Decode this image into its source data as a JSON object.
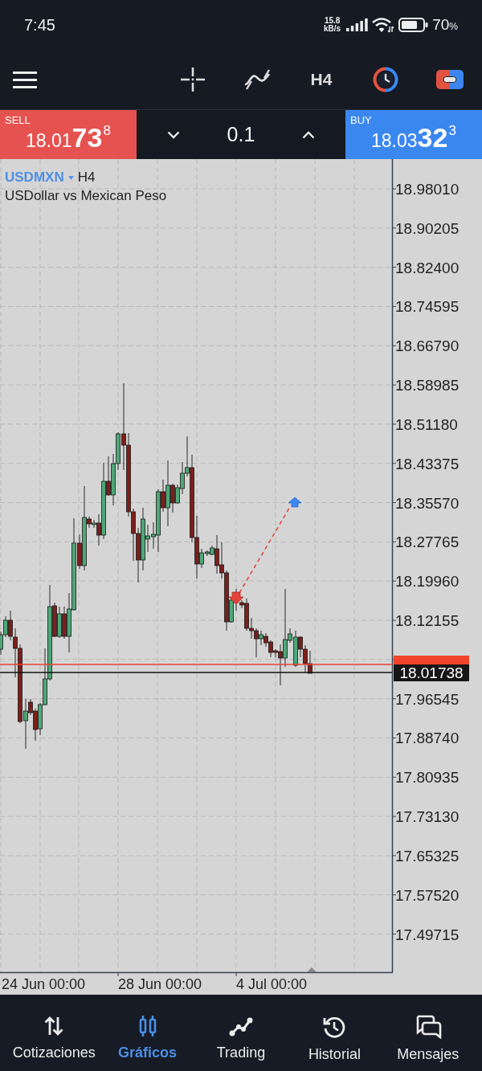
{
  "status_bar": {
    "time": "7:45",
    "net_speed": "15.8",
    "net_unit": "kB/s",
    "battery": "70",
    "battery_unit": "%"
  },
  "toolbar": {
    "timeframe": "H4"
  },
  "trade_panel": {
    "sell": {
      "label": "SELL",
      "price_main": "18.01",
      "price_big": "73",
      "price_sup": "8"
    },
    "volume": "0.1",
    "buy": {
      "label": "BUY",
      "price_main": "18.03",
      "price_big": "32",
      "price_sup": "3"
    }
  },
  "chart": {
    "symbol": "USDMXN",
    "timeframe": "H4",
    "description": "USDollar vs Mexican Peso",
    "price_labels": [
      "18.98010",
      "18.90205",
      "18.82400",
      "18.74595",
      "18.66790",
      "18.58985",
      "18.51180",
      "18.43375",
      "18.35570",
      "18.27765",
      "18.19960",
      "18.12155",
      "17.96545",
      "17.88740",
      "17.80935",
      "17.73130",
      "17.65325",
      "17.57520",
      "17.49715"
    ],
    "bid_tag": "18.01738",
    "time_labels": [
      "24 Jun 00:00",
      "28 Jun 00:00",
      "4 Jul 00:00"
    ]
  },
  "nav": [
    {
      "label": "Cotizaciones",
      "selected": false
    },
    {
      "label": "Gráficos",
      "selected": true
    },
    {
      "label": "Trading",
      "selected": false
    },
    {
      "label": "Historial",
      "selected": false
    },
    {
      "label": "Mensajes",
      "selected": false
    }
  ]
}
